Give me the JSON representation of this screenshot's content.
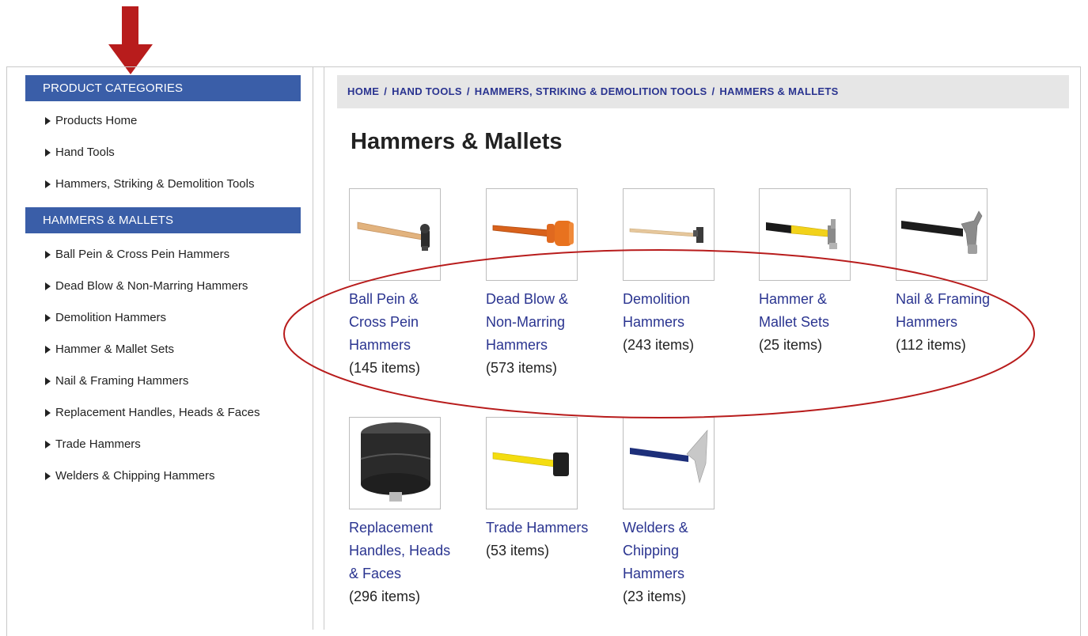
{
  "sidebar": {
    "categories_header": "PRODUCT CATEGORIES",
    "category_links": [
      {
        "label": "Products Home"
      },
      {
        "label": "Hand Tools"
      },
      {
        "label": "Hammers, Striking & Demolition Tools"
      }
    ],
    "section_header": "HAMMERS & MALLETS",
    "section_links": [
      {
        "label": "Ball Pein & Cross Pein Hammers"
      },
      {
        "label": "Dead Blow & Non-Marring Hammers"
      },
      {
        "label": "Demolition Hammers"
      },
      {
        "label": "Hammer & Mallet Sets"
      },
      {
        "label": "Nail & Framing Hammers"
      },
      {
        "label": "Replacement Handles, Heads & Faces"
      },
      {
        "label": "Trade Hammers"
      },
      {
        "label": "Welders & Chipping Hammers"
      }
    ]
  },
  "breadcrumb": {
    "separator": "/",
    "items": [
      {
        "label": "HOME"
      },
      {
        "label": "HAND TOOLS"
      },
      {
        "label": "HAMMERS, STRIKING & DEMOLITION TOOLS"
      },
      {
        "label": "HAMMERS & MALLETS"
      }
    ]
  },
  "page_title": "Hammers & Mallets",
  "products": [
    {
      "label": "Ball Pein & Cross Pein Hammers",
      "count": "(145 items)",
      "icon": "ball-pein-hammer-icon"
    },
    {
      "label": "Dead Blow & Non-Marring Hammers",
      "count": "(573 items)",
      "icon": "dead-blow-hammer-icon"
    },
    {
      "label": "Demolition Hammers",
      "count": "(243 items)",
      "icon": "demolition-hammer-icon"
    },
    {
      "label": "Hammer & Mallet Sets",
      "count": "(25 items)",
      "icon": "hammer-set-icon"
    },
    {
      "label": "Nail & Framing Hammers",
      "count": "(112 items)",
      "icon": "claw-hammer-icon"
    },
    {
      "label": "Replacement Handles, Heads & Faces",
      "count": "(296 items)",
      "icon": "replacement-face-icon"
    },
    {
      "label": "Trade Hammers",
      "count": "(53 items)",
      "icon": "trade-hammer-icon"
    },
    {
      "label": "Welders & Chipping Hammers",
      "count": "(23 items)",
      "icon": "chipping-hammer-icon"
    }
  ],
  "colors": {
    "header_blue": "#3a5ea8",
    "link_navy": "#2a3490",
    "annotation_red": "#b81c1c",
    "breadcrumb_bg": "#e6e6e6"
  }
}
